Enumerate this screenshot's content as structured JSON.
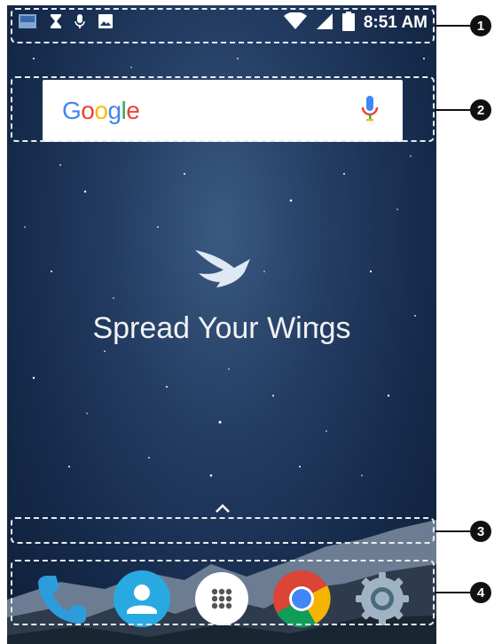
{
  "status_bar": {
    "time": "8:51 AM",
    "icons": [
      "screenshot-icon",
      "hourglass-icon",
      "mic-icon",
      "image-icon",
      "wifi-icon",
      "signal-icon",
      "battery-icon"
    ]
  },
  "search": {
    "brand": [
      "G",
      "o",
      "o",
      "g",
      "l",
      "e"
    ],
    "brand_colors": [
      "#4285F4",
      "#EA4335",
      "#FBBC05",
      "#4285F4",
      "#34A853",
      "#EA4335"
    ]
  },
  "wallpaper": {
    "tagline": "Spread Your Wings"
  },
  "dock": {
    "apps": [
      "phone-icon",
      "contacts-icon",
      "app-drawer-icon",
      "chrome-icon",
      "settings-icon"
    ]
  },
  "callouts": [
    "1",
    "2",
    "3",
    "4"
  ]
}
